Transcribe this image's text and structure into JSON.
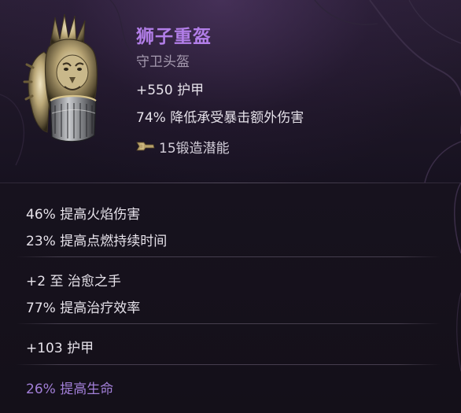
{
  "item": {
    "name": "狮子重盔",
    "type": "守卫头盔",
    "icon": "lion-helmet-icon",
    "base_stats": [
      "+550 护甲",
      "74% 降低承受暴击额外伤害"
    ],
    "forge": {
      "icon": "forge-hammer-icon",
      "text": "15锻造潜能"
    }
  },
  "affix_groups": [
    {
      "lines": [
        "46% 提高火焰伤害",
        "23% 提高点燃持续时间"
      ]
    },
    {
      "lines": [
        "+2 至 治愈之手",
        "77% 提高治疗效率"
      ]
    },
    {
      "lines": [
        "+103 护甲"
      ]
    },
    {
      "lines": [
        "26% 提高生命"
      ]
    }
  ],
  "colors": {
    "item_name": "#b27ee8",
    "item_type": "#a59aaf",
    "stat_text": "#e6e2ea",
    "highlight_affix": "#a27fd8",
    "background": "#17121e"
  }
}
